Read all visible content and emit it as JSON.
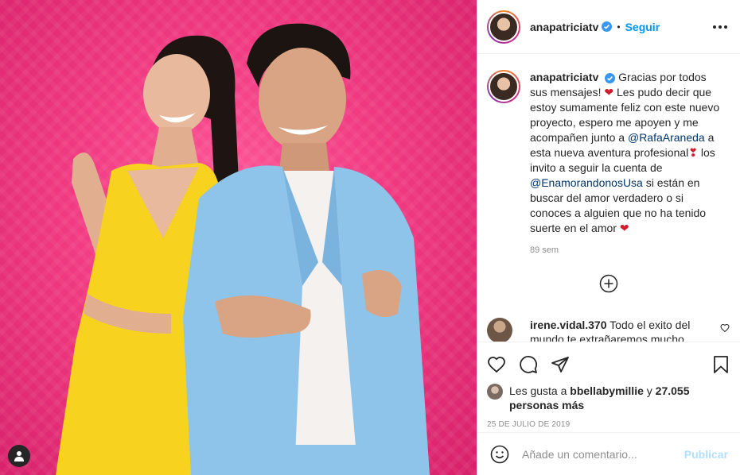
{
  "post": {
    "username": "anapatriciatv",
    "follow_label": "Seguir",
    "separator": "•",
    "caption": {
      "username": "anapatriciatv",
      "part1": "Gracias por todos sus mensajes!",
      "part2": "Les pudo decir que estoy sumamente feliz con este nuevo proyecto, espero me apoyen y me acompañen junto a",
      "mention1": "@RafaAraneda",
      "part3": "a esta nueva aventura profesional",
      "part4": "los invito a seguir la cuenta de",
      "mention2": "@EnamorandonosUsa",
      "part5": "si están en buscar del amor verdadero o si conoces a alguien que no ha tenido suerte en el amor",
      "time": "89 sem"
    },
    "comment": {
      "username": "irene.vidal.370",
      "text": "Todo el exito del mundo te extrañaremos mucho"
    },
    "likes": {
      "prefix": "Les gusta a",
      "user": "bbellabymillie",
      "joiner": "y",
      "others": "27.055 personas más"
    },
    "date": "25 DE JULIO DE 2019",
    "add_comment": {
      "placeholder": "Añade un comentario...",
      "publish_label": "Publicar"
    }
  },
  "colors": {
    "accent": "#0095f6",
    "background_pink": "#f13a82",
    "heart": "#d01c2c",
    "publish_disabled": "#b2dffc"
  },
  "icons": [
    "tag-user-icon",
    "verified-badge-icon",
    "more-options-icon",
    "load-more-icon",
    "heart-icon",
    "comment-icon",
    "share-icon",
    "bookmark-icon",
    "emoji-icon"
  ]
}
